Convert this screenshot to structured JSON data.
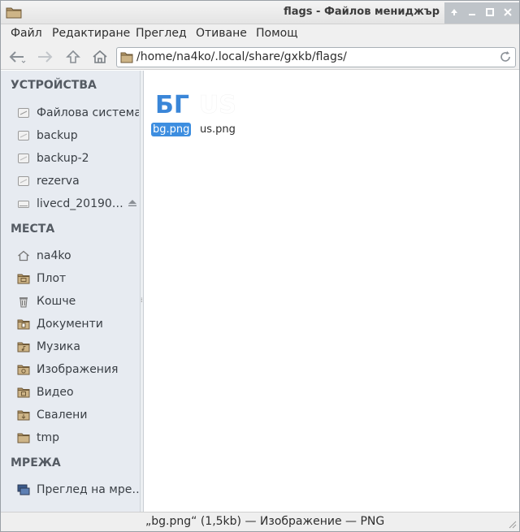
{
  "window": {
    "title": "flags - Файлов мениджър"
  },
  "menubar": {
    "items": [
      "Файл",
      "Редактиране",
      "Преглед",
      "Отиване",
      "Помощ"
    ]
  },
  "location": {
    "path": "/home/na4ko/.local/share/gxkb/flags/"
  },
  "sidebar": {
    "devices_title": "УСТРОЙСТВА",
    "devices": [
      {
        "label": "Файлова система",
        "icon": "drive-icon"
      },
      {
        "label": "backup",
        "icon": "drive-icon"
      },
      {
        "label": "backup-2",
        "icon": "drive-icon"
      },
      {
        "label": "rezerva",
        "icon": "drive-icon"
      },
      {
        "label": "livecd_20190…",
        "icon": "drive-icon",
        "eject": true
      }
    ],
    "places_title": "МЕСТА",
    "places": [
      {
        "label": "na4ko",
        "icon": "home-icon"
      },
      {
        "label": "Плот",
        "icon": "desktop-folder-icon"
      },
      {
        "label": "Кошче",
        "icon": "trash-icon"
      },
      {
        "label": "Документи",
        "icon": "documents-folder-icon"
      },
      {
        "label": "Музика",
        "icon": "music-folder-icon"
      },
      {
        "label": "Изображения",
        "icon": "pictures-folder-icon"
      },
      {
        "label": "Видео",
        "icon": "videos-folder-icon"
      },
      {
        "label": "Свалени",
        "icon": "downloads-folder-icon"
      },
      {
        "label": "tmp",
        "icon": "folder-icon"
      }
    ],
    "network_title": "МРЕЖА",
    "network": [
      {
        "label": "Преглед на мре…",
        "icon": "network-icon"
      }
    ]
  },
  "files": [
    {
      "name": "bg.png",
      "thumb_text": "БГ",
      "thumb_color": "#3a86d8",
      "selected": true
    },
    {
      "name": "us.png",
      "thumb_text": "US",
      "thumb_color": "#ffffff",
      "selected": false
    }
  ],
  "status": {
    "text": "„bg.png“ (1,5kb) — Изображение — PNG"
  },
  "colors": {
    "selection": "#3d8ee0",
    "sidebar_bg": "#e7ebf1",
    "folder": "#a88b5f"
  }
}
